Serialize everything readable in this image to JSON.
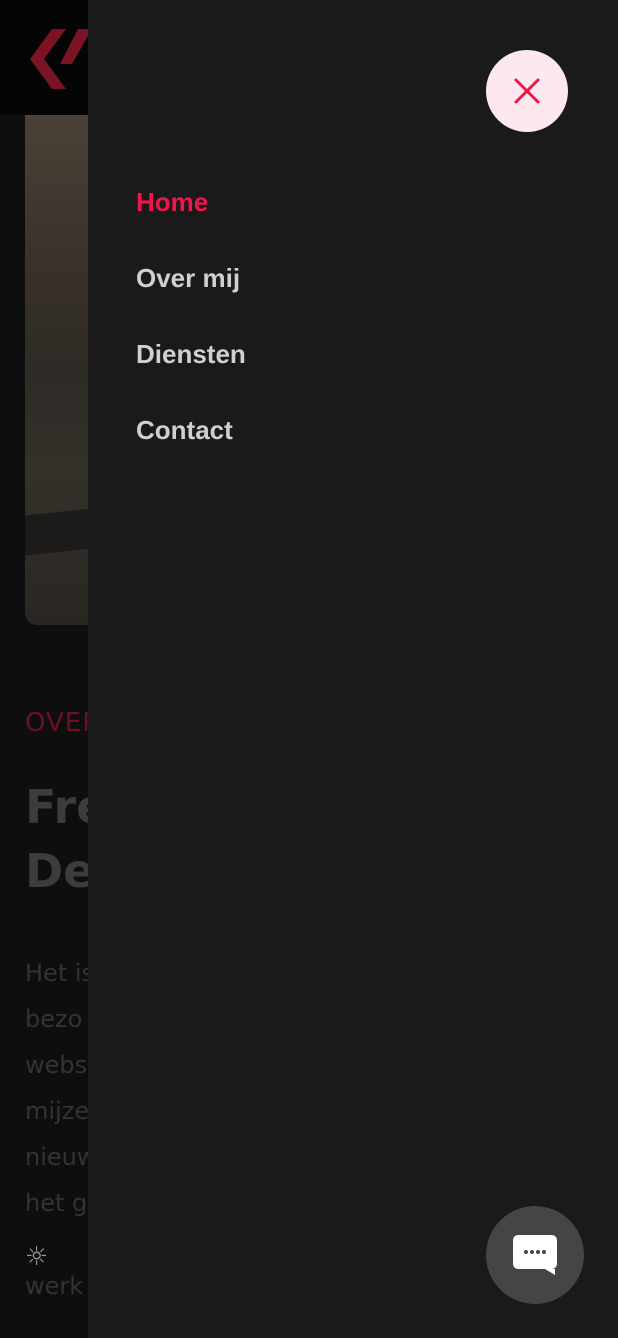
{
  "background_page": {
    "eyebrow": "OVER",
    "title": "Fre\nDe",
    "body": "Het is\nbezo\nwebs\nmijze\nnieuw\nhet g",
    "tail": "werk",
    "sun_glyph": "☼"
  },
  "menu": {
    "close_icon": "close-icon",
    "items": [
      {
        "label": "Home",
        "active": true
      },
      {
        "label": "Over mij",
        "active": false
      },
      {
        "label": "Diensten",
        "active": false
      },
      {
        "label": "Contact",
        "active": false
      }
    ]
  },
  "chat": {
    "icon": "chat-bubble-icon"
  },
  "colors": {
    "accent": "#f0164a",
    "drawer_bg": "#1a1a1a",
    "close_bg": "#fde8ee",
    "chat_bg": "#454545"
  }
}
